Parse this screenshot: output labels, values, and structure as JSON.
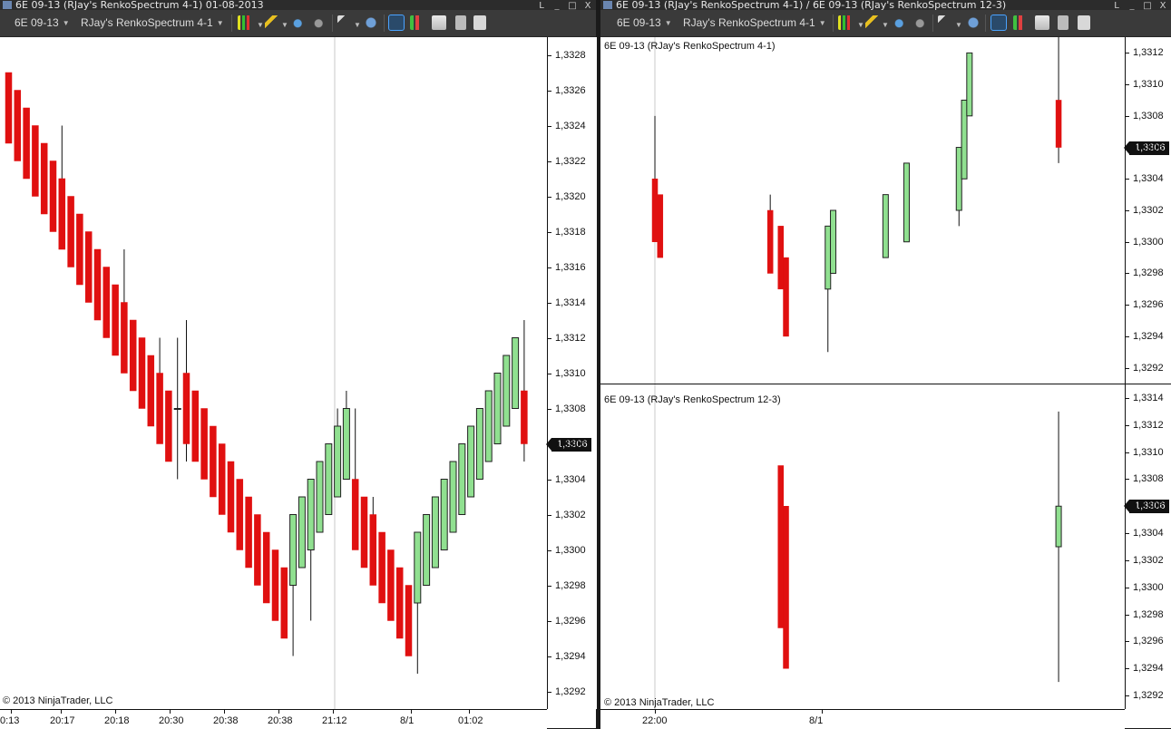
{
  "left_window": {
    "title": "6E 09-13 (RJay's RenkoSpectrum 4-1) 01-08-2013",
    "toolbar": {
      "instrument": "6E 09-13",
      "bar_type": "RJay's RenkoSpectrum 4-1"
    },
    "copyright": "© 2013 NinjaTrader, LLC",
    "last_price": "1,3306"
  },
  "right_window": {
    "title": "6E 09-13 (RJay's RenkoSpectrum 4-1) / 6E 09-13 (RJay's RenkoSpectrum 12-3)",
    "toolbar": {
      "instrument": "6E 09-13",
      "bar_type": "RJay's RenkoSpectrum 4-1"
    },
    "top_panel_label": "6E 09-13 (RJay's RenkoSpectrum 4-1)",
    "bottom_panel_label": "6E 09-13 (RJay's RenkoSpectrum 12-3)",
    "copyright": "© 2013 NinjaTrader, LLC",
    "top_last_price": "1,3306",
    "bottom_last_price": "1,3306"
  },
  "window_buttons": [
    "L",
    "_",
    "□",
    "X"
  ],
  "colors": {
    "up": "#90e090",
    "down": "#e01010",
    "outline": "#222222",
    "background": "#ffffff"
  },
  "chart_data": [
    {
      "type": "candlestick",
      "name": "left",
      "ylim": [
        1.3291,
        1.3329
      ],
      "yticks": [
        "1,3292",
        "1,3294",
        "1,3296",
        "1,3298",
        "1,3300",
        "1,3302",
        "1,3304",
        "1,3306",
        "1,3308",
        "1,3310",
        "1,3312",
        "1,3314",
        "1,3316",
        "1,3318",
        "1,3320",
        "1,3322",
        "1,3324",
        "1,3326",
        "1,3328"
      ],
      "xlabels": [
        "0:13",
        "20:17",
        "20:18",
        "20:30",
        "20:38",
        "20:38",
        "21:12",
        "8/1",
        "01:02"
      ],
      "bars": [
        {
          "o": 1.3327,
          "c": 1.3323
        },
        {
          "o": 1.3326,
          "c": 1.3322
        },
        {
          "o": 1.3325,
          "c": 1.3321
        },
        {
          "o": 1.3324,
          "c": 1.332
        },
        {
          "o": 1.3323,
          "c": 1.3319
        },
        {
          "o": 1.3322,
          "c": 1.3318,
          "h": 1.3322
        },
        {
          "o": 1.3321,
          "c": 1.3317,
          "h": 1.3324
        },
        {
          "o": 1.332,
          "c": 1.3316
        },
        {
          "o": 1.3319,
          "c": 1.3315
        },
        {
          "o": 1.3318,
          "c": 1.3314
        },
        {
          "o": 1.3317,
          "c": 1.3313
        },
        {
          "o": 1.3316,
          "c": 1.3312
        },
        {
          "o": 1.3315,
          "c": 1.3311
        },
        {
          "o": 1.3314,
          "c": 1.331,
          "h": 1.3317
        },
        {
          "o": 1.3313,
          "c": 1.3309
        },
        {
          "o": 1.3312,
          "c": 1.3308
        },
        {
          "o": 1.3311,
          "c": 1.3307
        },
        {
          "o": 1.331,
          "c": 1.3306,
          "h": 1.3312
        },
        {
          "o": 1.3309,
          "c": 1.3305
        },
        {
          "o": 1.3308,
          "c": 1.3308,
          "up": true,
          "o2": 1.3308,
          "c2": 1.3312,
          "h": 1.3312,
          "l": 1.3304
        },
        {
          "o": 1.331,
          "c": 1.3306,
          "h": 1.3313,
          "l": 1.3305
        },
        {
          "o": 1.3309,
          "c": 1.3305
        },
        {
          "o": 1.3308,
          "c": 1.3304
        },
        {
          "o": 1.3307,
          "c": 1.3303
        },
        {
          "o": 1.3306,
          "c": 1.3302
        },
        {
          "o": 1.3305,
          "c": 1.3301
        },
        {
          "o": 1.3304,
          "c": 1.33
        },
        {
          "o": 1.3303,
          "c": 1.3299
        },
        {
          "o": 1.3302,
          "c": 1.3298
        },
        {
          "o": 1.3301,
          "c": 1.3297
        },
        {
          "o": 1.33,
          "c": 1.3296
        },
        {
          "o": 1.3299,
          "c": 1.3295
        },
        {
          "o": 1.3298,
          "c": 1.3302,
          "up": true,
          "l": 1.3294
        },
        {
          "o": 1.3299,
          "c": 1.3303,
          "up": true
        },
        {
          "o": 1.33,
          "c": 1.3304,
          "up": true,
          "l": 1.3296
        },
        {
          "o": 1.3301,
          "c": 1.3305,
          "up": true
        },
        {
          "o": 1.3302,
          "c": 1.3306,
          "up": true
        },
        {
          "o": 1.3303,
          "c": 1.3307,
          "up": true,
          "h": 1.3308
        },
        {
          "o": 1.3304,
          "c": 1.3308,
          "up": true,
          "h": 1.3309
        },
        {
          "o": 1.3304,
          "c": 1.33,
          "h": 1.3308
        },
        {
          "o": 1.3303,
          "c": 1.3299
        },
        {
          "o": 1.3302,
          "c": 1.3298,
          "h": 1.3303
        },
        {
          "o": 1.3301,
          "c": 1.3297
        },
        {
          "o": 1.33,
          "c": 1.3296
        },
        {
          "o": 1.3299,
          "c": 1.3295
        },
        {
          "o": 1.3298,
          "c": 1.3294
        },
        {
          "o": 1.3297,
          "c": 1.3301,
          "up": true,
          "l": 1.3293
        },
        {
          "o": 1.3298,
          "c": 1.3302,
          "up": true
        },
        {
          "o": 1.3299,
          "c": 1.3303,
          "up": true
        },
        {
          "o": 1.33,
          "c": 1.3304,
          "up": true
        },
        {
          "o": 1.3301,
          "c": 1.3305,
          "up": true,
          "l": 1.3301
        },
        {
          "o": 1.3302,
          "c": 1.3306,
          "up": true
        },
        {
          "o": 1.3303,
          "c": 1.3307,
          "up": true
        },
        {
          "o": 1.3304,
          "c": 1.3308,
          "up": true
        },
        {
          "o": 1.3305,
          "c": 1.3309,
          "up": true
        },
        {
          "o": 1.3306,
          "c": 1.331,
          "up": true
        },
        {
          "o": 1.3307,
          "c": 1.3311,
          "up": true
        },
        {
          "o": 1.3308,
          "c": 1.3312,
          "up": true
        },
        {
          "o": 1.3309,
          "c": 1.3306,
          "h": 1.3313,
          "l": 1.3305
        }
      ]
    },
    {
      "type": "candlestick",
      "name": "right-top",
      "ylim": [
        1.3291,
        1.3313
      ],
      "yticks": [
        "1,3292",
        "1,3294",
        "1,3296",
        "1,3298",
        "1,3300",
        "1,3302",
        "1,3304",
        "1,3306",
        "1,3308",
        "1,3310",
        "1,3312"
      ],
      "xlabels": [
        "22:00",
        "8/1"
      ],
      "bars": [
        {
          "x": 0.09,
          "o": 1.3304,
          "c": 1.33,
          "h": 1.3308,
          "l": 1.33
        },
        {
          "x": 0.1,
          "o": 1.3303,
          "c": 1.3299
        },
        {
          "x": 0.31,
          "o": 1.3302,
          "c": 1.3298,
          "h": 1.3303
        },
        {
          "x": 0.33,
          "o": 1.3301,
          "c": 1.3297
        },
        {
          "x": 0.34,
          "o": 1.3299,
          "c": 1.3294
        },
        {
          "x": 0.42,
          "o": 1.3297,
          "c": 1.3301,
          "up": true,
          "l": 1.3293
        },
        {
          "x": 0.43,
          "o": 1.3298,
          "c": 1.3302,
          "up": true
        },
        {
          "x": 0.53,
          "o": 1.3299,
          "c": 1.3303,
          "up": true
        },
        {
          "x": 0.57,
          "o": 1.33,
          "c": 1.3305,
          "up": true
        },
        {
          "x": 0.67,
          "o": 1.3302,
          "c": 1.3306,
          "up": true,
          "l": 1.3301
        },
        {
          "x": 0.68,
          "o": 1.3304,
          "c": 1.3309,
          "up": true
        },
        {
          "x": 0.69,
          "o": 1.3308,
          "c": 1.3312,
          "up": true
        },
        {
          "x": 0.86,
          "o": 1.3309,
          "c": 1.3306,
          "h": 1.3313,
          "l": 1.3305
        }
      ]
    },
    {
      "type": "candlestick",
      "name": "right-bottom",
      "ylim": [
        1.3291,
        1.3315
      ],
      "yticks": [
        "1,3292",
        "1,3294",
        "1,3296",
        "1,3298",
        "1,3300",
        "1,3302",
        "1,3304",
        "1,3306",
        "1,3308",
        "1,3310",
        "1,3312",
        "1,3314"
      ],
      "xlabels": [
        "22:00",
        "8/1"
      ],
      "bars": [
        {
          "x": 0.33,
          "o": 1.3309,
          "c": 1.3297
        },
        {
          "x": 0.34,
          "o": 1.3306,
          "c": 1.3294
        },
        {
          "x": 0.86,
          "o": 1.3303,
          "c": 1.3306,
          "up": true,
          "h": 1.3313,
          "l": 1.3293
        }
      ]
    }
  ]
}
